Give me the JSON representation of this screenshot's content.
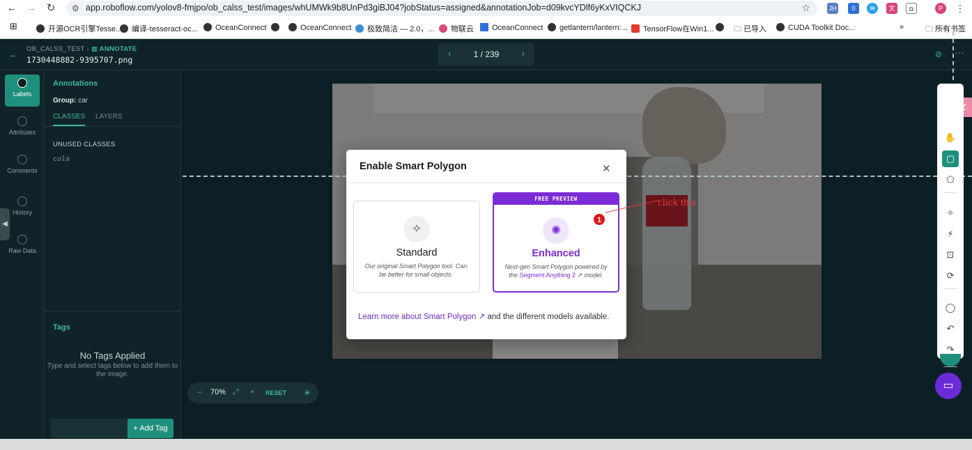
{
  "browser": {
    "url": "app.roboflow.com/yolov8-fmjpo/ob_calss_test/images/whUMWk9b8UnPd3giBJ04?jobStatus=assigned&annotationJob=d09kvcYDlf6yKxVIQCKJ",
    "ext_badge_count": "0",
    "bookmarks": [
      "开源OCR引擎Tesse...",
      "编译-tesseract-oc...",
      "OceanConnect",
      "OceanConnect",
      "极致简洁 — 2.0，...",
      "物联云",
      "OceanConnect",
      "getlantern/lantern:...",
      "TensorFlow在Win1...",
      "已导入",
      "CUDA Toolkit Doc...",
      "所有书签"
    ]
  },
  "header": {
    "crumb_project": "OB_CALSS_TEST",
    "crumb_section": "ANNOTATE",
    "filename": "1730448882-9395707.png",
    "pager": "1 / 239"
  },
  "rail": {
    "items": [
      {
        "label": "Labels",
        "icon": "tag-icon"
      },
      {
        "label": "Attributes",
        "icon": "list-icon"
      },
      {
        "label": "Comments",
        "icon": "comment-icon"
      },
      {
        "label": "History",
        "icon": "history-icon"
      },
      {
        "label": "Raw Data",
        "icon": "code-icon"
      }
    ]
  },
  "panel": {
    "title": "Annotations",
    "group_label": "Group:",
    "group_value": "car",
    "tab_classes": "CLASSES",
    "tab_layers": "LAYERS",
    "unused_heading": "UNUSED CLASSES",
    "unused_classes": [
      "cola"
    ],
    "tags_title": "Tags",
    "no_tags": "No Tags Applied",
    "no_tags_sub": "Type and select tags below to add them to the image.",
    "add_tag": "+ Add Tag"
  },
  "zoom": {
    "minus": "–",
    "value": "70%",
    "plus": "+",
    "reset": "RESET"
  },
  "modal": {
    "title": "Enable Smart Polygon",
    "standard": {
      "title": "Standard",
      "desc": "Our original Smart Polygon tool. Can be better for small objects."
    },
    "enhanced": {
      "banner": "FREE PREVIEW",
      "title": "Enhanced",
      "desc_before": "Next-gen Smart Polygon powered by the",
      "desc_link": "Segment Anything 2 ↗",
      "desc_after": "model."
    },
    "footer_link": "Learn more about Smart Polygon ↗",
    "footer_text": "and the different models available."
  },
  "overlay": {
    "step": "1",
    "note": "click this"
  },
  "colors": {
    "accent_teal": "#1f8f7d",
    "accent_purple": "#7b2cd6",
    "annotation_red": "#e01414"
  }
}
